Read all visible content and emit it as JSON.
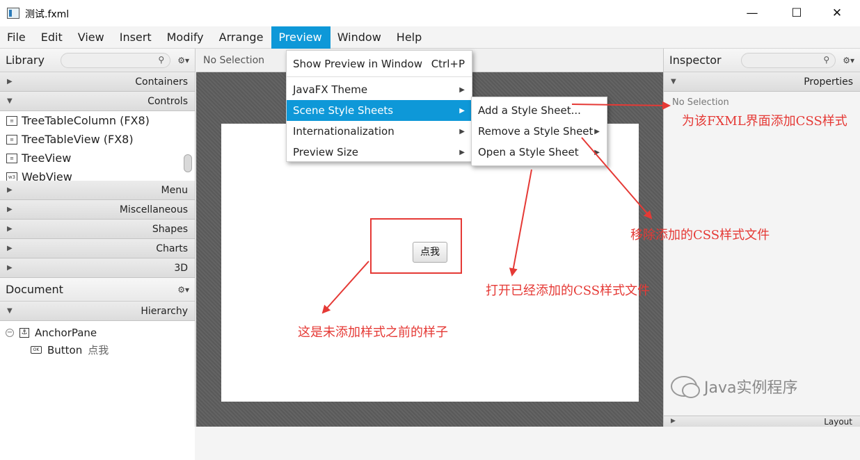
{
  "window": {
    "title": "测试.fxml",
    "minimize": "—",
    "maximize": "☐",
    "close": "✕"
  },
  "menubar": [
    "File",
    "Edit",
    "View",
    "Insert",
    "Modify",
    "Arrange",
    "Preview",
    "Window",
    "Help"
  ],
  "active_menu": "Preview",
  "library": {
    "title": "Library",
    "sections_top": [
      "Containers",
      "Controls"
    ],
    "items": [
      {
        "label": "TreeTableColumn  (FX8)",
        "icon": "table-column-icon"
      },
      {
        "label": "TreeTableView  (FX8)",
        "icon": "table-icon"
      },
      {
        "label": "TreeView",
        "icon": "tree-icon"
      },
      {
        "label": "WebView",
        "icon": "web-icon"
      }
    ],
    "sections_bottom": [
      "Menu",
      "Miscellaneous",
      "Shapes",
      "Charts",
      "3D"
    ]
  },
  "document": {
    "title": "Document",
    "hierarchy_label": "Hierarchy",
    "tree": [
      {
        "label": "AnchorPane",
        "sub": ""
      },
      {
        "label": "Button",
        "sub": "点我"
      }
    ]
  },
  "content": {
    "selection": "No Selection",
    "button_text": "点我"
  },
  "inspector": {
    "title": "Inspector",
    "section": "Properties",
    "selection": "No Selection",
    "layout": "Layout"
  },
  "preview_menu": [
    {
      "label": "Show Preview in Window",
      "shortcut": "Ctrl+P"
    },
    {
      "label": "JavaFX Theme",
      "submenu": true
    },
    {
      "label": "Scene Style Sheets",
      "submenu": true,
      "highlighted": true
    },
    {
      "label": "Internationalization",
      "submenu": true
    },
    {
      "label": "Preview Size",
      "submenu": true
    }
  ],
  "stylesheet_menu": [
    {
      "label": "Add a Style Sheet..."
    },
    {
      "label": "Remove a Style Sheet",
      "submenu": true
    },
    {
      "label": "Open a Style Sheet",
      "submenu": true
    }
  ],
  "annotations": {
    "add": "为该FXML界面添加CSS样式",
    "remove": "移除添加的CSS样式文件",
    "open": "打开已经添加的CSS样式文件",
    "before": "这是未添加样式之前的样子"
  },
  "watermark": "Java实例程序",
  "colors": {
    "accent": "#0e98d8",
    "annotation": "#e53935"
  }
}
